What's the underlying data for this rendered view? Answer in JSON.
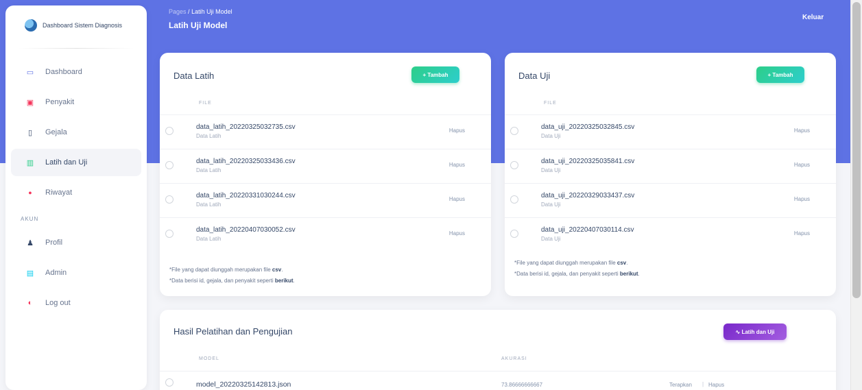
{
  "brand": {
    "title": "Dashboard Sistem Diagnosis"
  },
  "sidebar": {
    "items": [
      {
        "label": "Dashboard",
        "icon": "monitor-icon",
        "glyph": "▭",
        "color": "#5e72e4"
      },
      {
        "label": "Penyakit",
        "icon": "virus-icon",
        "glyph": "▣",
        "color": "#f5365c"
      },
      {
        "label": "Gejala",
        "icon": "clipboard-icon",
        "glyph": "▯",
        "color": "#344767"
      },
      {
        "label": "Latih dan Uji",
        "icon": "chart-icon",
        "glyph": "▥",
        "color": "#2dce89",
        "active": true
      },
      {
        "label": "Riwayat",
        "icon": "history-icon",
        "glyph": "●",
        "color": "#f5365c"
      }
    ],
    "section": "AKUN",
    "account_items": [
      {
        "label": "Profil",
        "icon": "user-icon",
        "glyph": "♟",
        "color": "#344767"
      },
      {
        "label": "Admin",
        "icon": "admin-icon",
        "glyph": "▤",
        "color": "#11cdef"
      },
      {
        "label": "Log out",
        "icon": "logout-icon",
        "glyph": "◐",
        "color": "#f5365c"
      }
    ]
  },
  "header": {
    "breadcrumb_root": "Pages",
    "breadcrumb_sep": "/",
    "breadcrumb_current": "Latih Uji Model",
    "title": "Latih Uji Model",
    "logout": "Keluar"
  },
  "data_latih": {
    "title": "Data Latih",
    "add_button": "+ Tambah",
    "column": "FILE",
    "rows": [
      {
        "file": "data_latih_20220325032735.csv",
        "sub": "Data Latih",
        "action": "Hapus"
      },
      {
        "file": "data_latih_20220325033436.csv",
        "sub": "Data Latih",
        "action": "Hapus"
      },
      {
        "file": "data_latih_20220331030244.csv",
        "sub": "Data Latih",
        "action": "Hapus"
      },
      {
        "file": "data_latih_20220407030052.csv",
        "sub": "Data Latih",
        "action": "Hapus"
      }
    ],
    "note1_prefix": "*File yang dapat diunggah merupakan file ",
    "note1_bold": "csv",
    "note1_suffix": ".",
    "note2_prefix": "*Data berisi id, gejala, dan penyakit seperti ",
    "note2_bold": "berikut",
    "note2_suffix": "."
  },
  "data_uji": {
    "title": "Data Uji",
    "add_button": "+ Tambah",
    "column": "FILE",
    "rows": [
      {
        "file": "data_uji_20220325032845.csv",
        "sub": "Data Uji",
        "action": "Hapus"
      },
      {
        "file": "data_uji_20220325035841.csv",
        "sub": "Data Uji",
        "action": "Hapus"
      },
      {
        "file": "data_uji_20220329033437.csv",
        "sub": "Data Uji",
        "action": "Hapus"
      },
      {
        "file": "data_uji_20220407030114.csv",
        "sub": "Data Uji",
        "action": "Hapus"
      }
    ],
    "note1_prefix": "*File yang dapat diunggah merupakan file ",
    "note1_bold": "csv",
    "note1_suffix": ".",
    "note2_prefix": "*Data berisi id, gejala, dan penyakit seperti ",
    "note2_bold": "berikut",
    "note2_suffix": "."
  },
  "hasil": {
    "title": "Hasil Pelatihan dan Pengujian",
    "button": "∿ Latih dan Uji",
    "col_model": "MODEL",
    "col_akurasi": "AKURASI",
    "rows": [
      {
        "model": "model_20220325142813.json",
        "akurasi": "73.86666666667",
        "apply": "Terapkan",
        "sep": "|",
        "delete": "Hapus"
      }
    ]
  }
}
